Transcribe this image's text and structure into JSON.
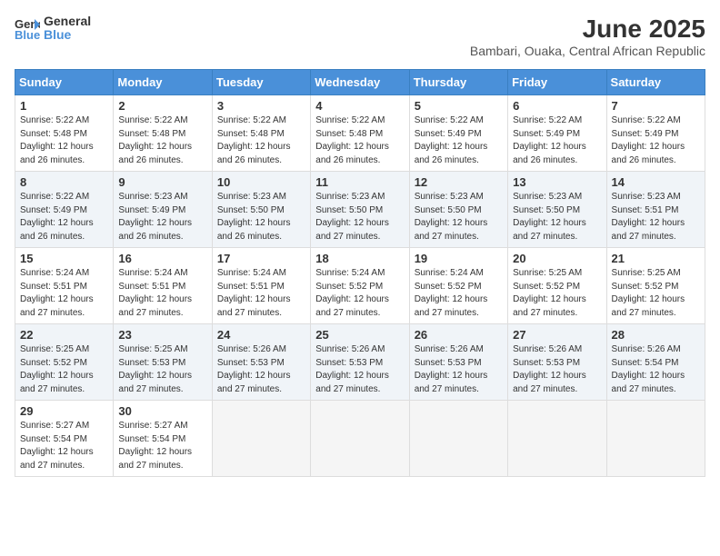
{
  "logo": {
    "line1": "General",
    "line2": "Blue"
  },
  "title": "June 2025",
  "location": "Bambari, Ouaka, Central African Republic",
  "days_header": [
    "Sunday",
    "Monday",
    "Tuesday",
    "Wednesday",
    "Thursday",
    "Friday",
    "Saturday"
  ],
  "weeks": [
    {
      "shaded": false,
      "days": [
        {
          "num": "1",
          "sunrise": "5:22 AM",
          "sunset": "5:48 PM",
          "daylight": "12 hours and 26 minutes."
        },
        {
          "num": "2",
          "sunrise": "5:22 AM",
          "sunset": "5:48 PM",
          "daylight": "12 hours and 26 minutes."
        },
        {
          "num": "3",
          "sunrise": "5:22 AM",
          "sunset": "5:48 PM",
          "daylight": "12 hours and 26 minutes."
        },
        {
          "num": "4",
          "sunrise": "5:22 AM",
          "sunset": "5:48 PM",
          "daylight": "12 hours and 26 minutes."
        },
        {
          "num": "5",
          "sunrise": "5:22 AM",
          "sunset": "5:49 PM",
          "daylight": "12 hours and 26 minutes."
        },
        {
          "num": "6",
          "sunrise": "5:22 AM",
          "sunset": "5:49 PM",
          "daylight": "12 hours and 26 minutes."
        },
        {
          "num": "7",
          "sunrise": "5:22 AM",
          "sunset": "5:49 PM",
          "daylight": "12 hours and 26 minutes."
        }
      ]
    },
    {
      "shaded": true,
      "days": [
        {
          "num": "8",
          "sunrise": "5:22 AM",
          "sunset": "5:49 PM",
          "daylight": "12 hours and 26 minutes."
        },
        {
          "num": "9",
          "sunrise": "5:23 AM",
          "sunset": "5:49 PM",
          "daylight": "12 hours and 26 minutes."
        },
        {
          "num": "10",
          "sunrise": "5:23 AM",
          "sunset": "5:50 PM",
          "daylight": "12 hours and 26 minutes."
        },
        {
          "num": "11",
          "sunrise": "5:23 AM",
          "sunset": "5:50 PM",
          "daylight": "12 hours and 27 minutes."
        },
        {
          "num": "12",
          "sunrise": "5:23 AM",
          "sunset": "5:50 PM",
          "daylight": "12 hours and 27 minutes."
        },
        {
          "num": "13",
          "sunrise": "5:23 AM",
          "sunset": "5:50 PM",
          "daylight": "12 hours and 27 minutes."
        },
        {
          "num": "14",
          "sunrise": "5:23 AM",
          "sunset": "5:51 PM",
          "daylight": "12 hours and 27 minutes."
        }
      ]
    },
    {
      "shaded": false,
      "days": [
        {
          "num": "15",
          "sunrise": "5:24 AM",
          "sunset": "5:51 PM",
          "daylight": "12 hours and 27 minutes."
        },
        {
          "num": "16",
          "sunrise": "5:24 AM",
          "sunset": "5:51 PM",
          "daylight": "12 hours and 27 minutes."
        },
        {
          "num": "17",
          "sunrise": "5:24 AM",
          "sunset": "5:51 PM",
          "daylight": "12 hours and 27 minutes."
        },
        {
          "num": "18",
          "sunrise": "5:24 AM",
          "sunset": "5:52 PM",
          "daylight": "12 hours and 27 minutes."
        },
        {
          "num": "19",
          "sunrise": "5:24 AM",
          "sunset": "5:52 PM",
          "daylight": "12 hours and 27 minutes."
        },
        {
          "num": "20",
          "sunrise": "5:25 AM",
          "sunset": "5:52 PM",
          "daylight": "12 hours and 27 minutes."
        },
        {
          "num": "21",
          "sunrise": "5:25 AM",
          "sunset": "5:52 PM",
          "daylight": "12 hours and 27 minutes."
        }
      ]
    },
    {
      "shaded": true,
      "days": [
        {
          "num": "22",
          "sunrise": "5:25 AM",
          "sunset": "5:52 PM",
          "daylight": "12 hours and 27 minutes."
        },
        {
          "num": "23",
          "sunrise": "5:25 AM",
          "sunset": "5:53 PM",
          "daylight": "12 hours and 27 minutes."
        },
        {
          "num": "24",
          "sunrise": "5:26 AM",
          "sunset": "5:53 PM",
          "daylight": "12 hours and 27 minutes."
        },
        {
          "num": "25",
          "sunrise": "5:26 AM",
          "sunset": "5:53 PM",
          "daylight": "12 hours and 27 minutes."
        },
        {
          "num": "26",
          "sunrise": "5:26 AM",
          "sunset": "5:53 PM",
          "daylight": "12 hours and 27 minutes."
        },
        {
          "num": "27",
          "sunrise": "5:26 AM",
          "sunset": "5:53 PM",
          "daylight": "12 hours and 27 minutes."
        },
        {
          "num": "28",
          "sunrise": "5:26 AM",
          "sunset": "5:54 PM",
          "daylight": "12 hours and 27 minutes."
        }
      ]
    },
    {
      "shaded": false,
      "days": [
        {
          "num": "29",
          "sunrise": "5:27 AM",
          "sunset": "5:54 PM",
          "daylight": "12 hours and 27 minutes."
        },
        {
          "num": "30",
          "sunrise": "5:27 AM",
          "sunset": "5:54 PM",
          "daylight": "12 hours and 27 minutes."
        },
        null,
        null,
        null,
        null,
        null
      ]
    }
  ],
  "labels": {
    "sunrise": "Sunrise:",
    "sunset": "Sunset:",
    "daylight": "Daylight:"
  }
}
